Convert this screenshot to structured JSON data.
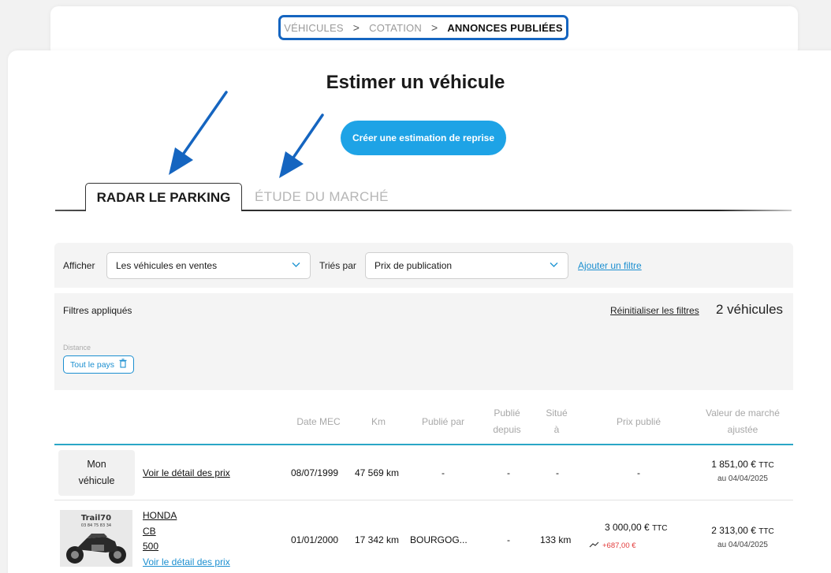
{
  "breadcrumb": {
    "items": [
      "VÉHICULES",
      "COTATION",
      "ANNONCES PUBLIÉES"
    ],
    "separator": ">"
  },
  "page": {
    "title": "Estimer un véhicule",
    "create_button": "Créer une estimation de reprise"
  },
  "tabs": {
    "active": "RADAR LE PARKING",
    "inactive": "ÉTUDE DU MARCHÉ"
  },
  "filters": {
    "show_label": "Afficher",
    "show_value": "Les véhicules en ventes",
    "sort_label": "Triés par",
    "sort_value": "Prix de publication",
    "add_filter": "Ajouter un filtre",
    "applied_title": "Filtres appliqués",
    "reset": "Réinitialiser les filtres",
    "count": "2 véhicules",
    "distance_label": "Distance",
    "distance_chip": "Tout le pays"
  },
  "table": {
    "headers": {
      "date": "Date MEC",
      "km": "Km",
      "publisher": "Publié par",
      "since_1": "Publié",
      "since_2": "depuis",
      "located_1": "Situé",
      "located_2": "à",
      "price": "Prix publié",
      "market_1": "Valeur de marché",
      "market_2": "ajustée"
    },
    "mine": {
      "label_1": "Mon",
      "label_2": "véhicule",
      "detail_link": "Voir le détail des prix",
      "date": "08/07/1999",
      "km": "47 569 km",
      "publisher": "-",
      "since": "-",
      "located": "-",
      "price": "-",
      "market": "1 851,00 €",
      "market_ttc": "TTC",
      "market_date": "au 04/04/2025"
    },
    "rows": [
      {
        "brand": "HONDA",
        "model": "CB",
        "version": "500",
        "detail_link": "Voir le détail des prix",
        "thumb_text_1": "Trail70",
        "thumb_text_2": "03 84 75 83 34",
        "date": "01/01/2000",
        "km": "17 342 km",
        "publisher": "BOURGOG...",
        "since": "-",
        "located": "133 km",
        "price": "3 000,00 €",
        "price_ttc": "TTC",
        "price_diff": "+687,00 €",
        "market": "2 313,00 €",
        "market_ttc": "TTC",
        "market_date": "au 04/04/2025"
      }
    ]
  },
  "colors": {
    "accent": "#1ea3e6",
    "link": "#1c8fd0",
    "breadcrumb_border": "#1565c0",
    "annotation_arrow": "#1565c0",
    "negative": "#e23a3a"
  }
}
